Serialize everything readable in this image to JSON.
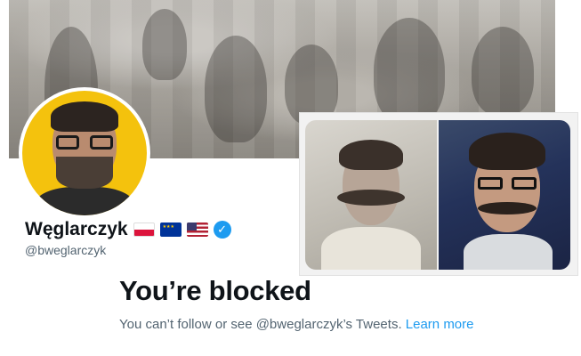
{
  "profile": {
    "display_name": "Węglarczyk",
    "handle": "@bweglarczyk",
    "flags": [
      "poland-flag",
      "eu-flag",
      "us-flag"
    ],
    "verified": "✓"
  },
  "blocked": {
    "title": "You’re blocked",
    "message": "You can’t follow or see @bweglarczyk’s Tweets.",
    "link_text": "Learn more"
  },
  "colors": {
    "accent": "#1d9bf0",
    "text_primary": "#0f1419",
    "text_secondary": "#536471",
    "avatar_bg": "#f4c20d"
  },
  "icons": {
    "verified": "verified-badge-icon"
  }
}
